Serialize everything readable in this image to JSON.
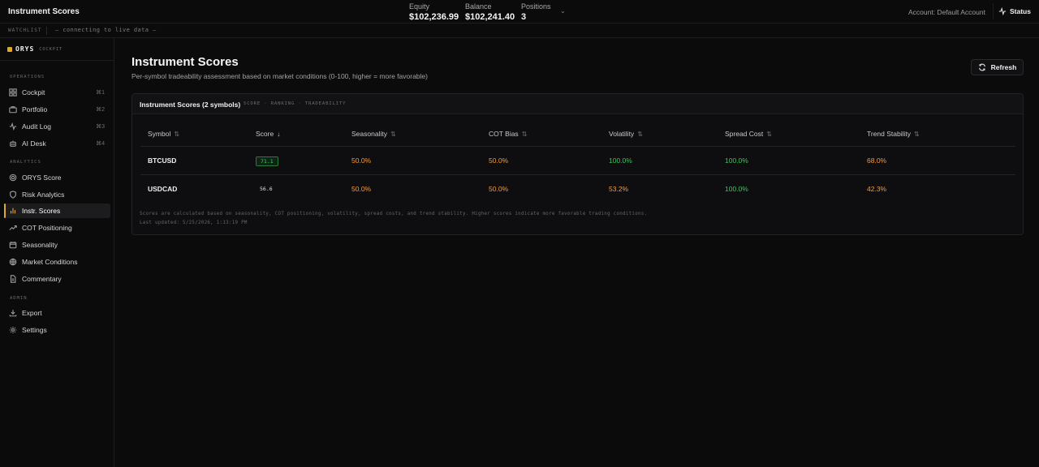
{
  "topbar": {
    "title": "Instrument Scores",
    "metrics": [
      {
        "label": "Equity",
        "value": "$102,236.99"
      },
      {
        "label": "Balance",
        "value": "$102,241.40"
      },
      {
        "label": "Positions",
        "value": "3"
      }
    ],
    "account": "Account: Default Account",
    "status_label": "Status"
  },
  "watchlist": {
    "label": "WATCHLIST",
    "status": "— connecting to live data —"
  },
  "sidebar": {
    "brand": "ORYS",
    "brand_sub": "COCKPIT",
    "sections": [
      {
        "label": "OPERATIONS",
        "items": [
          {
            "label": "Cockpit",
            "shortcut": "⌘1",
            "icon": "grid-icon"
          },
          {
            "label": "Portfolio",
            "shortcut": "⌘2",
            "icon": "briefcase-icon"
          },
          {
            "label": "Audit Log",
            "shortcut": "⌘3",
            "icon": "activity-icon"
          },
          {
            "label": "AI Desk",
            "shortcut": "⌘4",
            "icon": "bot-icon"
          }
        ]
      },
      {
        "label": "ANALYTICS",
        "items": [
          {
            "label": "ORYS Score",
            "icon": "target-icon"
          },
          {
            "label": "Risk Analytics",
            "icon": "shield-icon"
          },
          {
            "label": "Instr. Scores",
            "icon": "bar-chart-icon",
            "active": true
          },
          {
            "label": "COT Positioning",
            "icon": "trending-up-icon"
          },
          {
            "label": "Seasonality",
            "icon": "calendar-icon"
          },
          {
            "label": "Market Conditions",
            "icon": "globe-icon"
          },
          {
            "label": "Commentary",
            "icon": "document-icon"
          }
        ]
      },
      {
        "label": "ADMIN",
        "items": [
          {
            "label": "Export",
            "icon": "download-icon"
          },
          {
            "label": "Settings",
            "icon": "gear-icon"
          }
        ]
      }
    ]
  },
  "main": {
    "title": "Instrument Scores",
    "subtitle": "Per-symbol tradeability assessment based on market conditions (0-100, higher = more favorable)",
    "refresh_label": "Refresh",
    "card": {
      "title": "Instrument Scores (2 symbols)",
      "tag": "SCORE · RANKING · TRADEABILITY",
      "columns": [
        "Symbol",
        "Score",
        "Seasonality",
        "COT Bias",
        "Volatility",
        "Spread Cost",
        "Trend Stability"
      ],
      "rows": [
        {
          "symbol": "BTCUSD",
          "score": "71.1",
          "seasonality": "50.0%",
          "cot_bias": "50.0%",
          "volatility": "100.0%",
          "spread_cost": "100.0%",
          "trend_stability": "68.0%"
        },
        {
          "symbol": "USDCAD",
          "score": "56.6",
          "seasonality": "50.0%",
          "cot_bias": "50.0%",
          "volatility": "53.2%",
          "spread_cost": "100.0%",
          "trend_stability": "42.3%"
        }
      ],
      "footnote": "Scores are calculated based on seasonality, COT positioning, volatility, spread costs, and trend stability. Higher scores indicate more favorable trading conditions.",
      "last_updated": "Last updated: 5/25/2026, 1:13:19 PM"
    }
  },
  "colors": {
    "accent": "#e3a72d",
    "positive": "#3fc55c",
    "neutral": "#f59a3a",
    "background": "#0b0b0c"
  }
}
